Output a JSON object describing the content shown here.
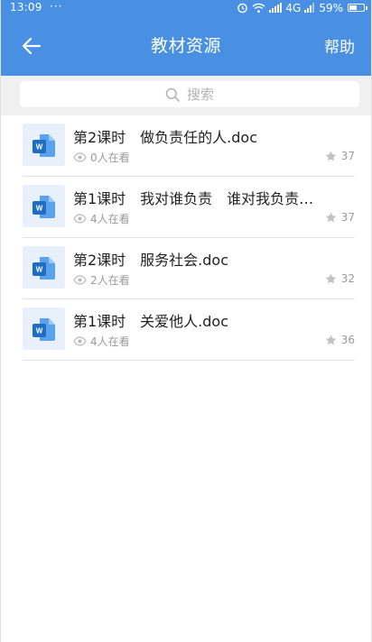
{
  "status_bar": {
    "time": "13:09",
    "dots": "···",
    "network": "4G",
    "battery": "59%",
    "battery_level": 0.59
  },
  "header": {
    "title": "教材资源",
    "help_label": "帮助"
  },
  "search": {
    "placeholder": "搜索"
  },
  "files": [
    {
      "name": "第2课时　做负责任的人.doc",
      "viewers": "0人在看",
      "stars": "37"
    },
    {
      "name": "第1课时　我对谁负责　谁对我负责…",
      "viewers": "4人在看",
      "stars": "37"
    },
    {
      "name": "第2课时　服务社会.doc",
      "viewers": "2人在看",
      "stars": "32"
    },
    {
      "name": "第1课时　关爱他人.doc",
      "viewers": "4人在看",
      "stars": "36"
    }
  ],
  "icons": {
    "file": "word-doc-icon",
    "views": "eye-icon",
    "stars": "star-icon"
  },
  "colors": {
    "header": "#4a90e2",
    "word_blue": "#2b7cd3",
    "search_bg": "#f0f0f0"
  }
}
